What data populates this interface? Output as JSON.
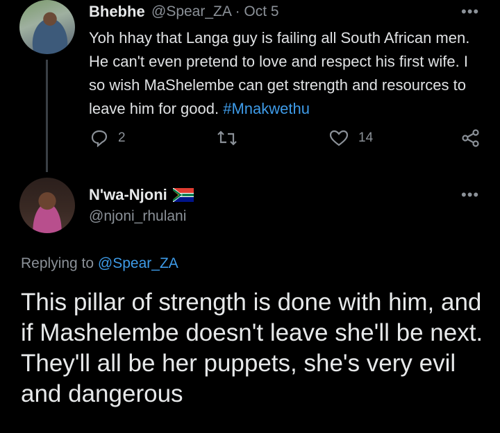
{
  "parent_tweet": {
    "display_name": "Bhebhe",
    "handle": "@Spear_ZA",
    "separator": "·",
    "date": "Oct 5",
    "more_icon": "more-horizontal-icon",
    "text": "Yoh hhay that Langa guy is failing all South African men. He can't even pretend to love and respect his first wife. I so wish MaShelembe can get strength and resources to leave him for good.",
    "hashtag": "#Mnakwethu",
    "actions": {
      "reply_count": "2",
      "retweet_count": "",
      "like_count": "14"
    }
  },
  "reply_tweet": {
    "display_name": "N'wa-Njoni",
    "flag_icon": "south-africa-flag-icon",
    "handle": "@njoni_rhulani",
    "replying_prefix": "Replying to",
    "replying_handle": "@Spear_ZA",
    "text": "This pillar of strength is done with him, and if Mashelembe doesn't leave she'll be next. They'll all be her puppets, she's very evil and dangerous"
  },
  "colors": {
    "background": "#000000",
    "link": "#3e9be8",
    "secondary_text": "#8b9198"
  }
}
